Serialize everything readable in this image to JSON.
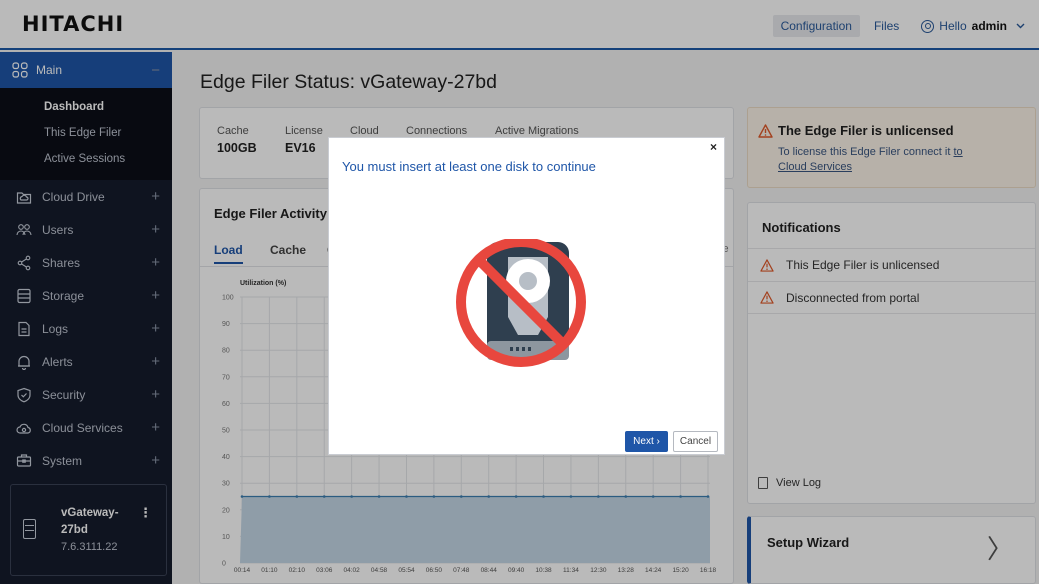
{
  "header": {
    "logo": "HITACHI",
    "links": {
      "configuration": "Configuration",
      "files": "Files"
    },
    "greeting": "Hello",
    "username": "admin"
  },
  "sidebar": {
    "main_label": "Main",
    "main_collapse": "−",
    "sub_items": [
      "Dashboard",
      "This Edge Filer",
      "Active Sessions"
    ],
    "items": [
      {
        "label": "Cloud Drive",
        "icon": "cloud-drive-icon"
      },
      {
        "label": "Users",
        "icon": "users-icon"
      },
      {
        "label": "Shares",
        "icon": "share-icon"
      },
      {
        "label": "Storage",
        "icon": "storage-icon"
      },
      {
        "label": "Logs",
        "icon": "logs-icon"
      },
      {
        "label": "Alerts",
        "icon": "bell-icon"
      },
      {
        "label": "Security",
        "icon": "shield-icon"
      },
      {
        "label": "Cloud Services",
        "icon": "cloud-services-icon"
      },
      {
        "label": "System",
        "icon": "system-icon"
      }
    ],
    "expand_symbol": "+",
    "device": {
      "name": "vGateway-27bd",
      "version": "7.6.3111.22",
      "menu": "⋮"
    }
  },
  "page": {
    "title": "Edge Filer Status: vGateway-27bd"
  },
  "stats": {
    "cache": {
      "label": "Cache",
      "value": "100GB"
    },
    "license": {
      "label": "License",
      "value": "EV16"
    },
    "cloud": {
      "label": "Cloud"
    },
    "connections": {
      "label": "Connections"
    },
    "migrations": {
      "label": "Active Migrations"
    }
  },
  "activity": {
    "title": "Edge Filer Activity",
    "tabs": [
      "Load",
      "Cache"
    ],
    "tab_partial_left": "C",
    "tab_partial_right": "le"
  },
  "unlicensed_banner": {
    "title": "The Edge Filer is unlicensed",
    "text": "To license this Edge Filer connect it",
    "link_to": "to",
    "link": "Cloud Services"
  },
  "notifications": {
    "title": "Notifications",
    "items": [
      "This Edge Filer is unlicensed",
      "Disconnected from portal"
    ],
    "view_log": "View Log"
  },
  "setup_wizard": {
    "title": "Setup Wizard",
    "chevron": "〉"
  },
  "modal": {
    "message": "You must insert at least one disk to continue",
    "close": "×",
    "next": "Next ›",
    "cancel": "Cancel",
    "graphic": "no-disk-icon"
  },
  "colors": {
    "accent": "#1f56a8",
    "sidebar_bg": "#151c2c",
    "warning": "#e0592a",
    "prohibit_red": "#e8473e",
    "chart_fill": "#c5d8e7",
    "chart_line": "#3c7fb1"
  },
  "chart_data": {
    "type": "area",
    "title": "Utilization (%)",
    "ylim": [
      0,
      100
    ],
    "yticks": [
      0,
      10,
      20,
      30,
      40,
      50,
      60,
      70,
      80,
      90,
      100
    ],
    "x": [
      "00:14",
      "01:10",
      "02:10",
      "03:06",
      "04:02",
      "04:58",
      "05:54",
      "06:50",
      "07:48",
      "08:44",
      "09:40",
      "10:38",
      "11:34",
      "12:30",
      "13:28",
      "14:24",
      "15:20",
      "16:18"
    ],
    "values": [
      25,
      25,
      25,
      25,
      25,
      25,
      25,
      25,
      25,
      25,
      25,
      25,
      25,
      25,
      25,
      25,
      25,
      25
    ],
    "grid": true
  }
}
